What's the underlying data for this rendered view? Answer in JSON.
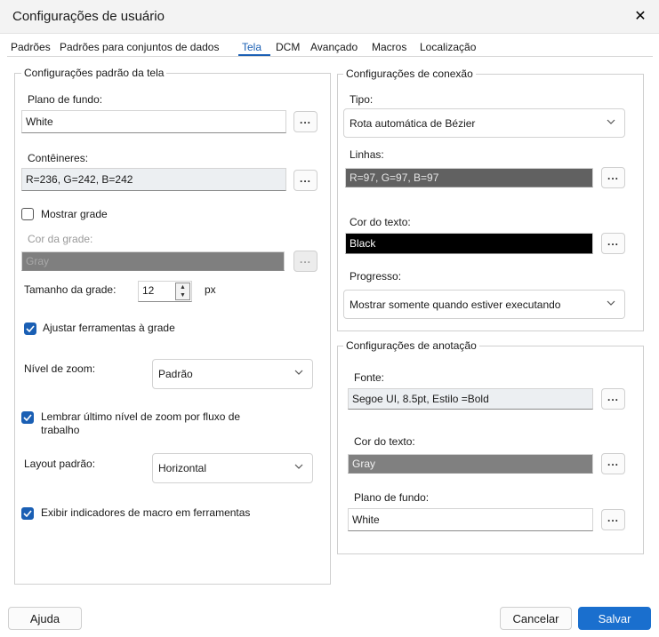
{
  "window": {
    "title": "Configurações de usuário",
    "close_glyph": "✕"
  },
  "tabs": [
    {
      "label": "Padrões"
    },
    {
      "label": "Padrões para conjuntos de dados"
    },
    {
      "label": "Tela"
    },
    {
      "label": "DCM"
    },
    {
      "label": "Avançado"
    },
    {
      "label": "Macros"
    },
    {
      "label": "Localização"
    }
  ],
  "active_tab": "Tela",
  "screen": {
    "legend": "Configurações padrão da tela",
    "background_label": "Plano de fundo:",
    "background_value": "White",
    "containers_label": "Contêineres:",
    "containers_value": "R=236, G=242, B=242",
    "show_grid_label": "Mostrar grade",
    "show_grid_checked": false,
    "grid_color_label": "Cor da grade:",
    "grid_color_value": "Gray",
    "grid_size_label": "Tamanho da grade:",
    "grid_size_value": "12",
    "grid_size_unit": "px",
    "snap_label": "Ajustar ferramentas à grade",
    "snap_checked": true,
    "zoom_label": "Nível de zoom:",
    "zoom_value": "Padrão",
    "remember_zoom_label_1": "Lembrar último nível de zoom por fluxo de",
    "remember_zoom_label_2": "trabalho",
    "remember_zoom_checked": true,
    "layout_label": "Layout padrão:",
    "layout_value": "Horizontal",
    "macro_indicators_label": "Exibir indicadores de macro em ferramentas",
    "macro_indicators_checked": true,
    "ellipsis": "..."
  },
  "connection": {
    "legend": "Configurações de conexão",
    "type_label": "Tipo:",
    "type_value": "Rota automática de Bézier",
    "lines_label": "Linhas:",
    "lines_value": "R=97, G=97, B=97",
    "text_color_label": "Cor do texto:",
    "text_color_value": "Black",
    "progress_label": "Progresso:",
    "progress_value": "Mostrar somente quando estiver executando"
  },
  "annotation": {
    "legend": "Configurações de anotação",
    "font_label": "Fonte:",
    "font_value": "Segoe UI, 8.5pt, Estilo =Bold",
    "text_color_label": "Cor do texto:",
    "text_color_value": "Gray",
    "background_label": "Plano de fundo:",
    "background_value": "White"
  },
  "footer": {
    "help": "Ajuda",
    "cancel": "Cancelar",
    "save": "Salvar"
  },
  "colors": {
    "accent": "#1a5fb4",
    "lines_swatch": "#616161",
    "grid_swatch": "#7f7f7f",
    "annotation_text_swatch": "#808080"
  }
}
